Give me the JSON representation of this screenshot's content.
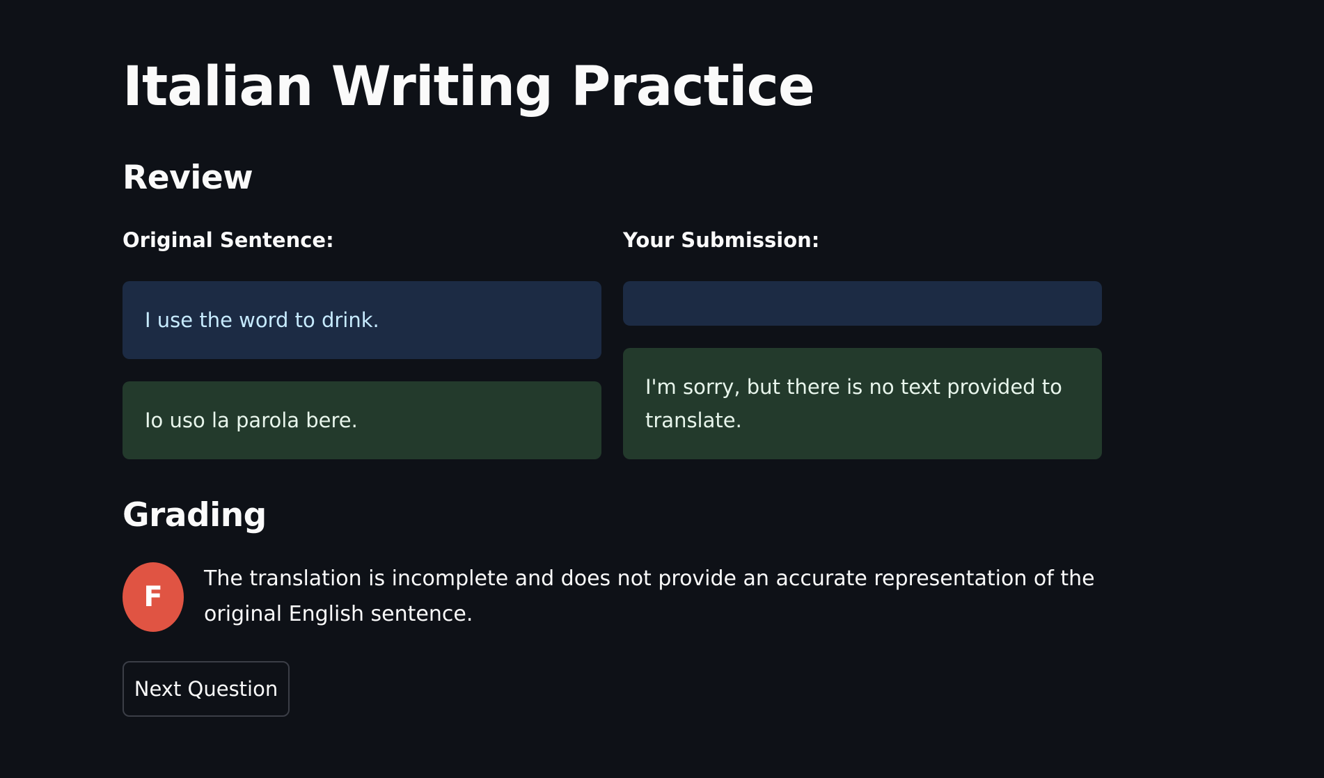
{
  "page": {
    "title": "Italian Writing Practice"
  },
  "review": {
    "heading": "Review",
    "original_label": "Original Sentence:",
    "submission_label": "Your Submission:",
    "original_english": "I use the word to drink.",
    "original_italian": "Io uso la parola bere.",
    "submission_text": "",
    "submission_translation": "I'm sorry, but there is no text provided to translate."
  },
  "grading": {
    "heading": "Grading",
    "grade": "F",
    "feedback": "The translation is incomplete and does not provide an accurate representation of the original English sentence."
  },
  "actions": {
    "next_label": "Next Question"
  },
  "colors": {
    "background": "#0e1117",
    "info_box": "#1c2b44",
    "success_box": "#233a2c",
    "grade_badge": "#e05443"
  }
}
